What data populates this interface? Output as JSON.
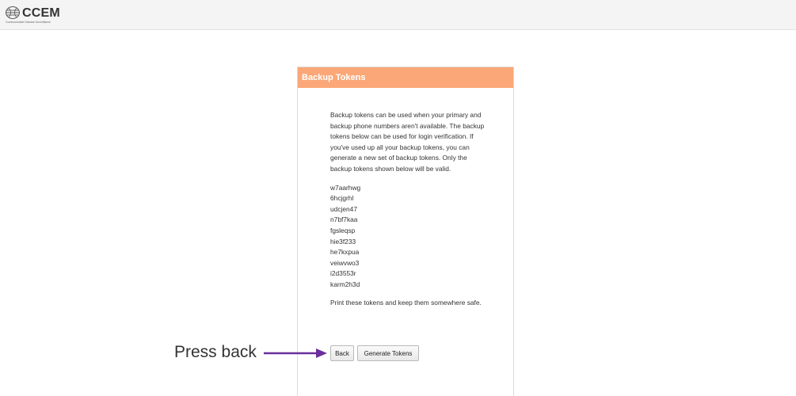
{
  "header": {
    "logo_text": "CCEM",
    "logo_tagline": "Communicable Disease Surveillance",
    "logo_icon": "globe-icon",
    "background": "#f4f4f4"
  },
  "panel": {
    "title": "Backup Tokens",
    "header_color": "#fba777",
    "intro": "Backup tokens can be used when your primary and backup phone numbers aren't available. The backup tokens below can be used for login verification. If you've used up all your backup tokens, you can generate a new set of backup tokens. Only the backup tokens shown below will be valid.",
    "tokens": [
      "w7aarhwg",
      "6hcjgrhl",
      "udcjen47",
      "n7bf7kaa",
      "fgsleqsp",
      "hie3f233",
      "he7kxpua",
      "veiwvwo3",
      "i2d3553r",
      "karm2h3d"
    ],
    "print_note": "Print these tokens and keep them somewhere safe.",
    "buttons": {
      "back": "Back",
      "generate": "Generate Tokens"
    }
  },
  "annotation": {
    "text": "Press back",
    "arrow_icon": "right-arrow-icon",
    "arrow_color": "#6b2f9c"
  }
}
